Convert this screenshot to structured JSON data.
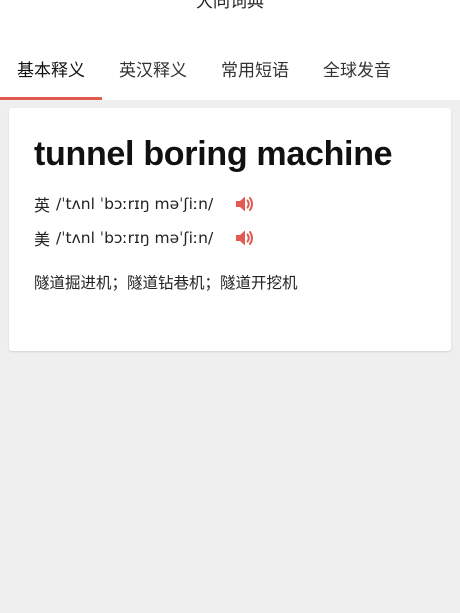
{
  "header": {
    "title": "大同词典"
  },
  "tabs": [
    {
      "label": "基本释义",
      "active": true
    },
    {
      "label": "英汉释义",
      "active": false
    },
    {
      "label": "常用短语",
      "active": false
    },
    {
      "label": "全球发音",
      "active": false
    }
  ],
  "colors": {
    "accent": "#e25a52",
    "background": "#efeff0",
    "card": "#ffffff"
  },
  "entry": {
    "word": "tunnel boring machine",
    "uk": {
      "label": "英",
      "phonetic": "/ˈtʌnl ˈbɔːrɪŋ məˈʃiːn/",
      "icon": "speaker-icon"
    },
    "us": {
      "label": "美",
      "phonetic": "/ˈtʌnl ˈbɔːrɪŋ məˈʃiːn/",
      "icon": "speaker-icon"
    },
    "definition": "隧道掘进机；隧道钻巷机；隧道开挖机"
  }
}
